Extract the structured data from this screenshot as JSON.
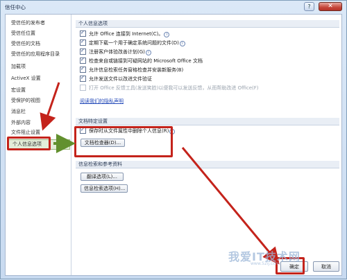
{
  "window": {
    "title": "信任中心",
    "help_label": "?",
    "close_label": "✕"
  },
  "sidebar": {
    "items": [
      {
        "label": "受信任的发布者"
      },
      {
        "label": "受信任位置"
      },
      {
        "label": "受信任的文档"
      },
      {
        "label": "受信任的应用程序目录"
      },
      {
        "label": "加载项"
      },
      {
        "label": "ActiveX 设置"
      },
      {
        "label": "宏设置"
      },
      {
        "label": "受保护的视图"
      },
      {
        "label": "消息栏"
      },
      {
        "label": "外部内容"
      },
      {
        "label": "文件阻止设置"
      },
      {
        "label": "个人信息选项",
        "active": true
      }
    ]
  },
  "sections": {
    "personal": {
      "header": "个人信息选项",
      "options": [
        {
          "label": "允许 Office 连接到 Internet(C)。",
          "checked": true,
          "info": true
        },
        {
          "label": "定期下载一个用于确定系统问题的文件(D)",
          "checked": true,
          "info": true
        },
        {
          "label": "注册客户体验改善计划(G)",
          "checked": true,
          "info": true
        },
        {
          "label": "检查来自或链接到可疑网站的 Microsoft Office 文档",
          "checked": true,
          "info": false
        },
        {
          "label": "允许信息检索任务窗格检查并安装新服务(B)",
          "checked": true,
          "info": false
        },
        {
          "label": "允许发送文件以改进文件验证",
          "checked": true,
          "info": false
        },
        {
          "label": "打开 Office 反馈工具(发送笑脸)以便我可以发送反馈，从而帮助改进 Office(F)",
          "checked": false,
          "info": false,
          "disabled": true
        }
      ],
      "privacy_link": "阅读我们的隐私声明"
    },
    "document": {
      "header": "文档特定设置",
      "remove_option": {
        "label": "保存时从文件属性中删除个人信息(R)",
        "checked": true
      },
      "inspector_button": "文档检查器(D)..."
    },
    "research": {
      "header": "信息检索和参考资料",
      "translate_button": "翻译选项(L)...",
      "research_button": "信息检索选项(H)..."
    }
  },
  "footer": {
    "ok_button": "确定",
    "cancel_button": "取消"
  },
  "watermark": {
    "text": "我爱IT技术网",
    "subtext": "www.52ij.com"
  },
  "annotation_color": "#c4231b"
}
